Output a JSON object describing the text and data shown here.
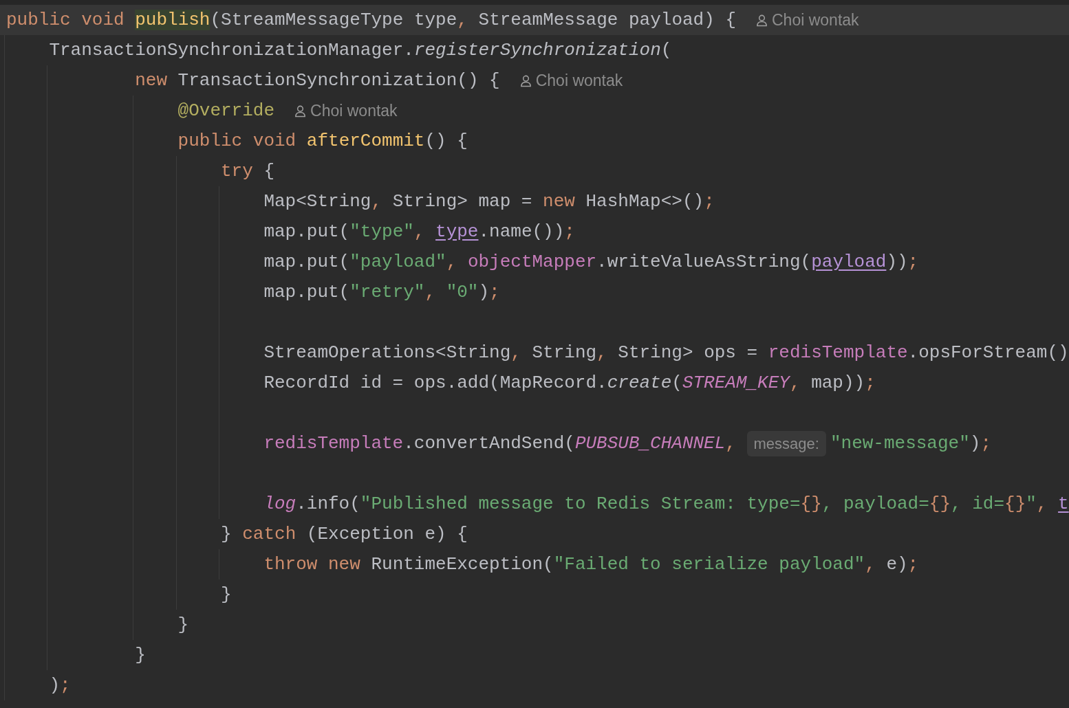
{
  "editor": {
    "lines": [
      {
        "current": true,
        "tokens": [
          {
            "kind": "kw",
            "text": "public void "
          },
          {
            "kind": "decl-hl",
            "text": "publish"
          },
          {
            "kind": "plain",
            "text": "(StreamMessageType type"
          },
          {
            "kind": "punct",
            "text": ", "
          },
          {
            "kind": "plain",
            "text": "StreamMessage payload) {"
          },
          {
            "kind": "author",
            "text": "Choi wontak"
          }
        ],
        "children": [
          {
            "tokens": [
              {
                "kind": "plain",
                "text": "TransactionSynchronizationManager."
              },
              {
                "kind": "italic",
                "text": "registerSynchronization"
              },
              {
                "kind": "plain",
                "text": "("
              }
            ],
            "children": [
              {
                "tokens": [
                  {
                    "kind": "kw",
                    "text": "new "
                  },
                  {
                    "kind": "plain",
                    "text": "TransactionSynchronization() {"
                  },
                  {
                    "kind": "author",
                    "text": "Choi wontak"
                  }
                ],
                "children": [
                  {
                    "tokens": [
                      {
                        "kind": "anno",
                        "text": "@Override"
                      },
                      {
                        "kind": "author",
                        "text": "Choi wontak"
                      }
                    ]
                  },
                  {
                    "tokens": [
                      {
                        "kind": "kw",
                        "text": "public void "
                      },
                      {
                        "kind": "decl",
                        "text": "afterCommit"
                      },
                      {
                        "kind": "plain",
                        "text": "() {"
                      }
                    ],
                    "children": [
                      {
                        "tokens": [
                          {
                            "kind": "kw",
                            "text": "try "
                          },
                          {
                            "kind": "plain",
                            "text": "{"
                          }
                        ],
                        "children": [
                          {
                            "tokens": [
                              {
                                "kind": "plain",
                                "text": "Map<String"
                              },
                              {
                                "kind": "punct",
                                "text": ", "
                              },
                              {
                                "kind": "plain",
                                "text": "String> map = "
                              },
                              {
                                "kind": "kw",
                                "text": "new "
                              },
                              {
                                "kind": "plain",
                                "text": "HashMap<>()"
                              },
                              {
                                "kind": "punct",
                                "text": ";"
                              }
                            ]
                          },
                          {
                            "tokens": [
                              {
                                "kind": "plain",
                                "text": "map.put("
                              },
                              {
                                "kind": "str",
                                "text": "\"type\""
                              },
                              {
                                "kind": "punct",
                                "text": ", "
                              },
                              {
                                "kind": "param",
                                "text": "type"
                              },
                              {
                                "kind": "plain",
                                "text": ".name())"
                              },
                              {
                                "kind": "punct",
                                "text": ";"
                              }
                            ]
                          },
                          {
                            "tokens": [
                              {
                                "kind": "plain",
                                "text": "map.put("
                              },
                              {
                                "kind": "str",
                                "text": "\"payload\""
                              },
                              {
                                "kind": "punct",
                                "text": ", "
                              },
                              {
                                "kind": "field",
                                "text": "objectMapper"
                              },
                              {
                                "kind": "plain",
                                "text": ".writeValueAsString("
                              },
                              {
                                "kind": "param",
                                "text": "payload"
                              },
                              {
                                "kind": "plain",
                                "text": "))"
                              },
                              {
                                "kind": "punct",
                                "text": ";"
                              }
                            ]
                          },
                          {
                            "tokens": [
                              {
                                "kind": "plain",
                                "text": "map.put("
                              },
                              {
                                "kind": "str",
                                "text": "\"retry\""
                              },
                              {
                                "kind": "punct",
                                "text": ", "
                              },
                              {
                                "kind": "str",
                                "text": "\"0\""
                              },
                              {
                                "kind": "plain",
                                "text": ")"
                              },
                              {
                                "kind": "punct",
                                "text": ";"
                              }
                            ]
                          },
                          {
                            "blank_before": true,
                            "tokens": [
                              {
                                "kind": "plain",
                                "text": "StreamOperations<String"
                              },
                              {
                                "kind": "punct",
                                "text": ", "
                              },
                              {
                                "kind": "plain",
                                "text": "String"
                              },
                              {
                                "kind": "punct",
                                "text": ", "
                              },
                              {
                                "kind": "plain",
                                "text": "String> ops = "
                              },
                              {
                                "kind": "field",
                                "text": "redisTemplate"
                              },
                              {
                                "kind": "plain",
                                "text": ".opsForStream()"
                              }
                            ]
                          },
                          {
                            "tokens": [
                              {
                                "kind": "plain",
                                "text": "RecordId id = ops.add(MapRecord."
                              },
                              {
                                "kind": "italic",
                                "text": "create"
                              },
                              {
                                "kind": "plain",
                                "text": "("
                              },
                              {
                                "kind": "static",
                                "text": "STREAM_KEY"
                              },
                              {
                                "kind": "punct",
                                "text": ", "
                              },
                              {
                                "kind": "plain",
                                "text": "map))"
                              },
                              {
                                "kind": "punct",
                                "text": ";"
                              }
                            ]
                          },
                          {
                            "blank_before": true,
                            "tokens": [
                              {
                                "kind": "field",
                                "text": "redisTemplate"
                              },
                              {
                                "kind": "plain",
                                "text": ".convertAndSend("
                              },
                              {
                                "kind": "static",
                                "text": "PUBSUB_CHANNEL"
                              },
                              {
                                "kind": "punct",
                                "text": ", "
                              },
                              {
                                "kind": "hint",
                                "text": "message:"
                              },
                              {
                                "kind": "str",
                                "text": "\"new-message\""
                              },
                              {
                                "kind": "plain",
                                "text": ")"
                              },
                              {
                                "kind": "punct",
                                "text": ";"
                              }
                            ]
                          },
                          {
                            "blank_before": true,
                            "tokens": [
                              {
                                "kind": "static",
                                "text": "log"
                              },
                              {
                                "kind": "plain",
                                "text": ".info("
                              },
                              {
                                "kind": "str",
                                "text": "\"Published message to Redis Stream: type="
                              },
                              {
                                "kind": "fmt",
                                "text": "{}"
                              },
                              {
                                "kind": "str",
                                "text": ", payload="
                              },
                              {
                                "kind": "fmt",
                                "text": "{}"
                              },
                              {
                                "kind": "str",
                                "text": ", id="
                              },
                              {
                                "kind": "fmt",
                                "text": "{}"
                              },
                              {
                                "kind": "str",
                                "text": "\""
                              },
                              {
                                "kind": "punct",
                                "text": ", "
                              },
                              {
                                "kind": "param",
                                "text": "t"
                              }
                            ]
                          }
                        ]
                      },
                      {
                        "tokens": [
                          {
                            "kind": "plain",
                            "text": "} "
                          },
                          {
                            "kind": "kw",
                            "text": "catch "
                          },
                          {
                            "kind": "plain",
                            "text": "(Exception e) {"
                          }
                        ],
                        "children": [
                          {
                            "tokens": [
                              {
                                "kind": "kw",
                                "text": "throw new "
                              },
                              {
                                "kind": "plain",
                                "text": "RuntimeException("
                              },
                              {
                                "kind": "str",
                                "text": "\"Failed to serialize payload\""
                              },
                              {
                                "kind": "punct",
                                "text": ", "
                              },
                              {
                                "kind": "plain",
                                "text": "e)"
                              },
                              {
                                "kind": "punct",
                                "text": ";"
                              }
                            ]
                          }
                        ]
                      },
                      {
                        "tokens": [
                          {
                            "kind": "plain",
                            "text": "}"
                          }
                        ]
                      }
                    ]
                  },
                  {
                    "tokens": [
                      {
                        "kind": "plain",
                        "text": "}"
                      }
                    ]
                  }
                ]
              },
              {
                "tokens": [
                  {
                    "kind": "plain",
                    "text": "}"
                  }
                ]
              }
            ]
          },
          {
            "tokens": [
              {
                "kind": "plain",
                "text": ")"
              },
              {
                "kind": "punct",
                "text": ";"
              }
            ]
          }
        ]
      }
    ]
  }
}
